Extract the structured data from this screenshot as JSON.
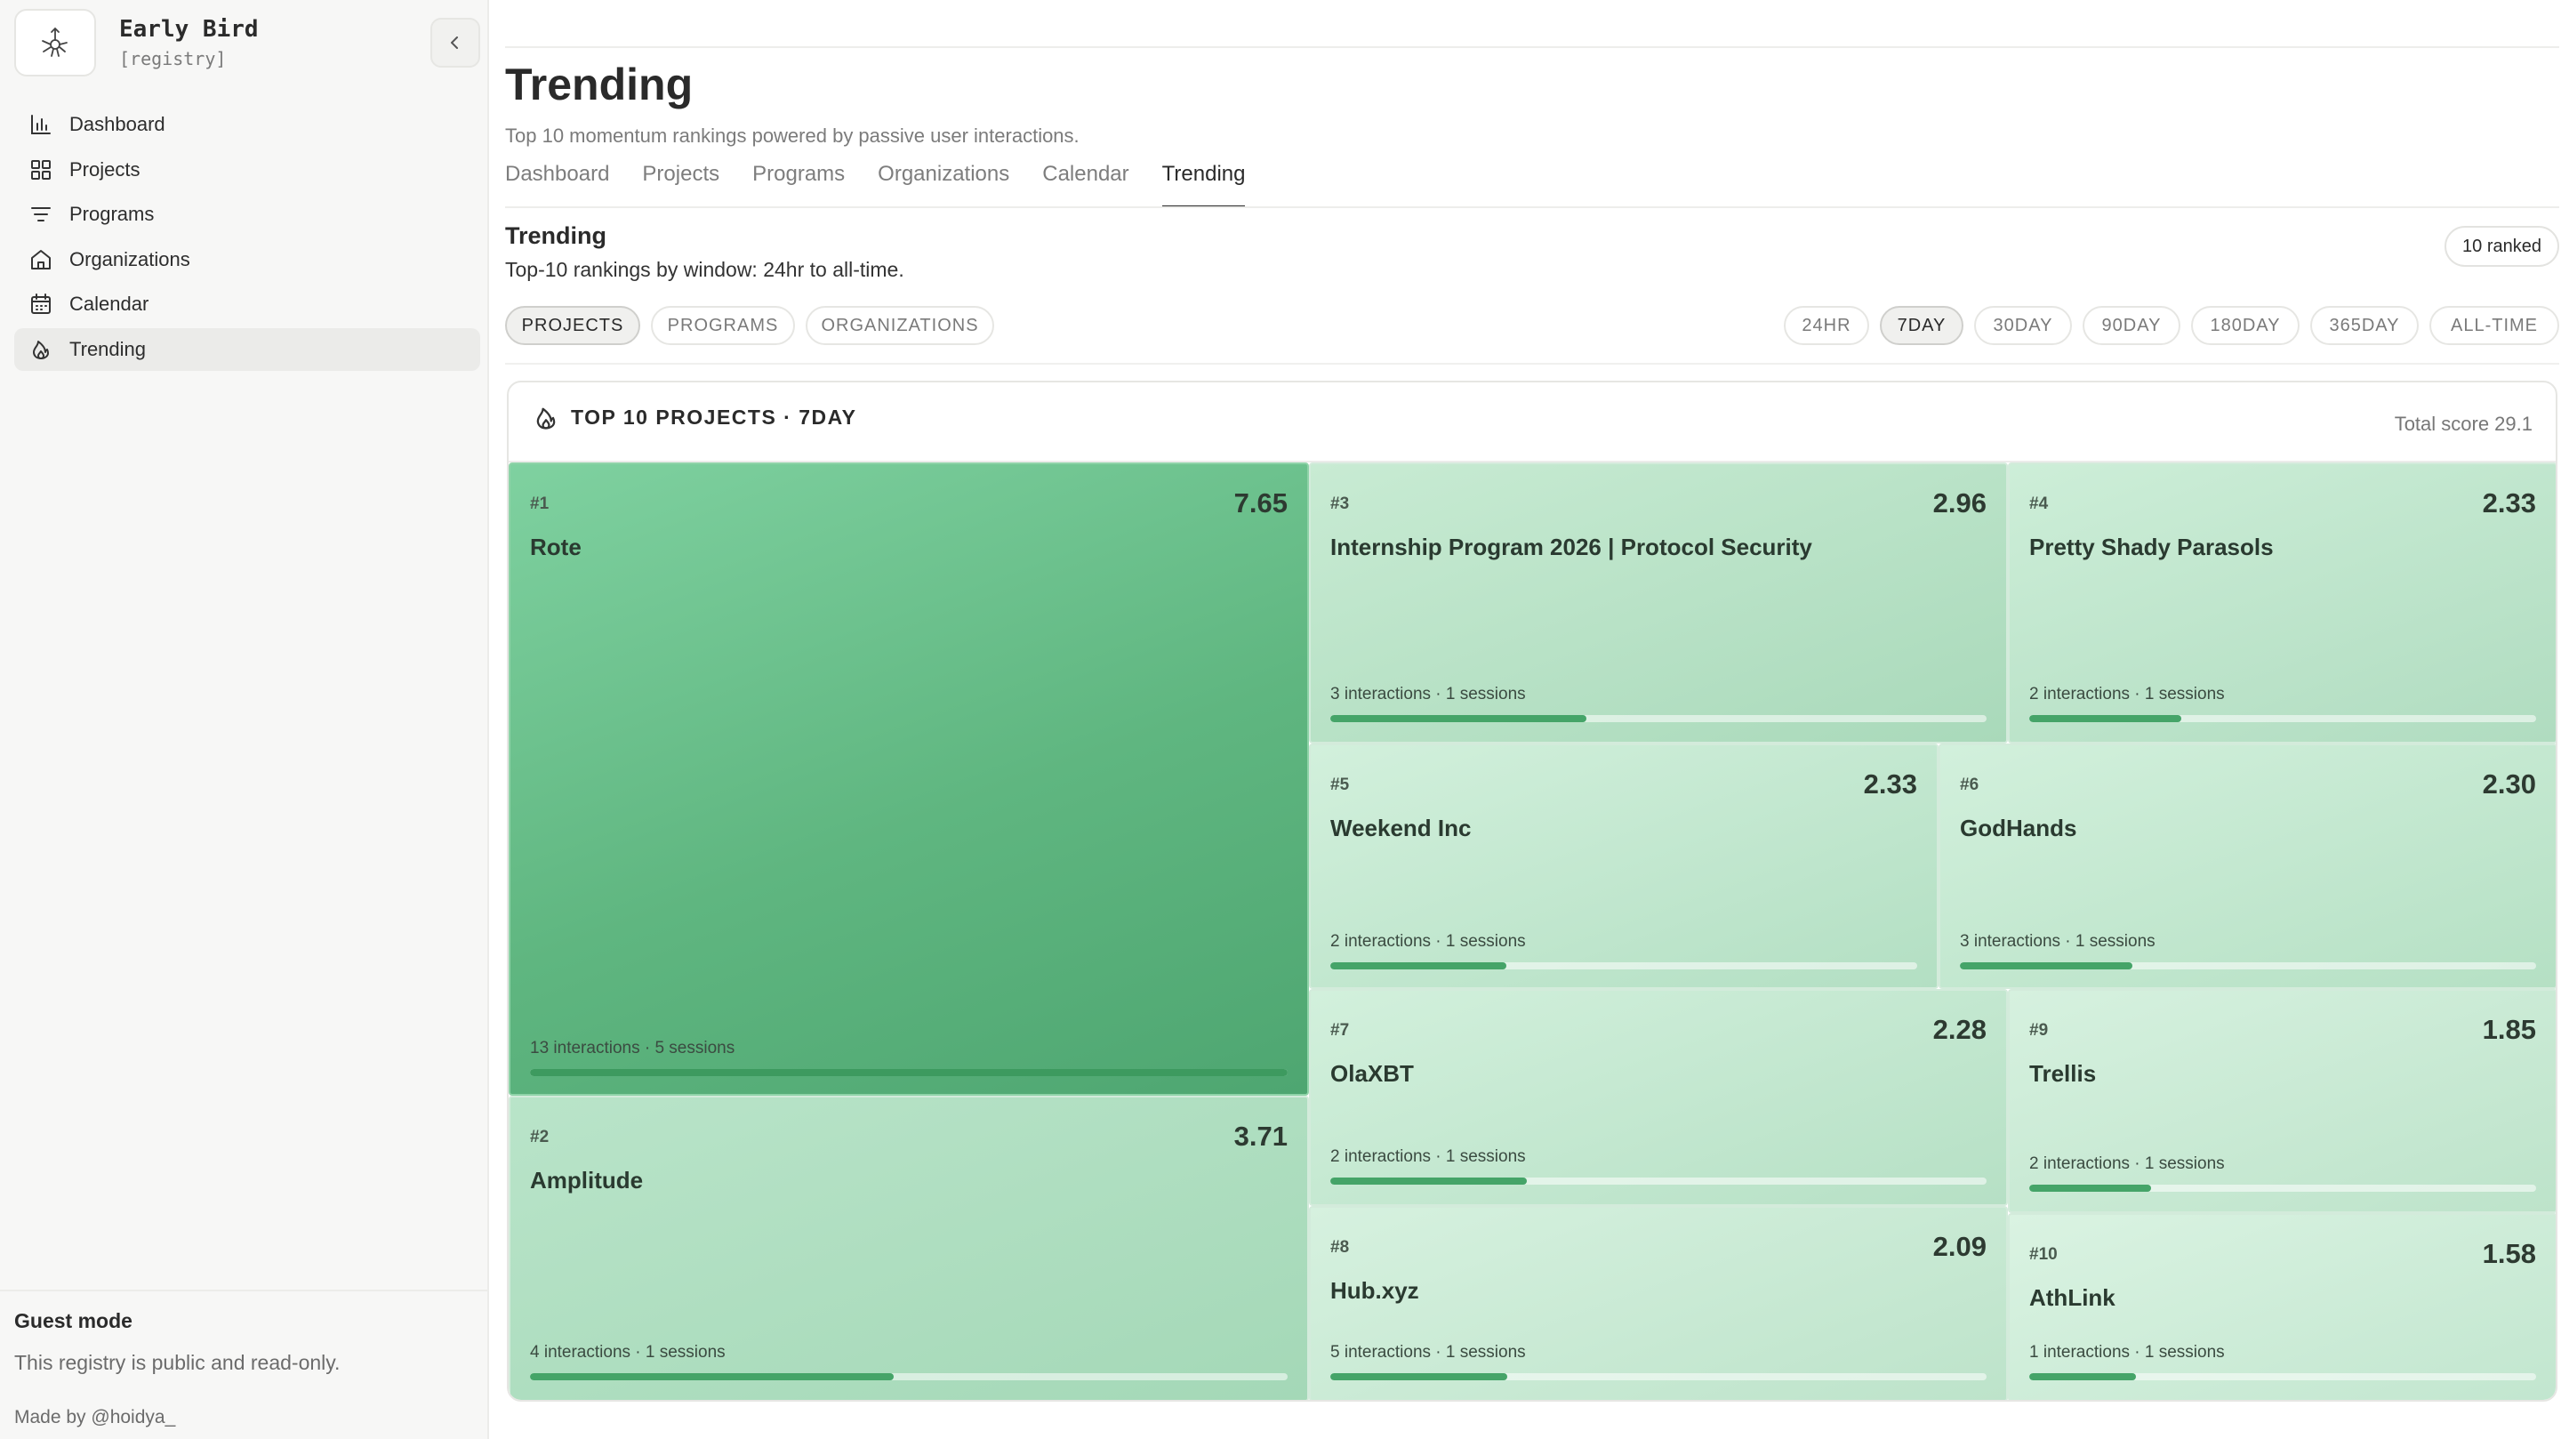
{
  "brand": {
    "name": "Early Bird",
    "sub": "[registry]"
  },
  "sidebar": {
    "items": [
      {
        "label": "Dashboard",
        "icon": "bar-chart-icon"
      },
      {
        "label": "Projects",
        "icon": "grid-icon"
      },
      {
        "label": "Programs",
        "icon": "filter-lines-icon"
      },
      {
        "label": "Organizations",
        "icon": "home-icon"
      },
      {
        "label": "Calendar",
        "icon": "calendar-icon"
      },
      {
        "label": "Trending",
        "icon": "flame-icon",
        "active": true
      }
    ],
    "guest_title": "Guest mode",
    "guest_desc": "This registry is public and read-only.",
    "made_by": "Made by @hoidya_"
  },
  "header": {
    "title": "Trending",
    "subtitle": "Top 10 momentum rankings powered by passive user interactions.",
    "tabs": [
      "Dashboard",
      "Projects",
      "Programs",
      "Organizations",
      "Calendar",
      "Trending"
    ],
    "active_tab": "Trending"
  },
  "section": {
    "title": "Trending",
    "subtitle": "Top-10 rankings by window: 24hr to all-time.",
    "ranked_badge": "10 ranked"
  },
  "filters": {
    "types": [
      "PROJECTS",
      "PROGRAMS",
      "ORGANIZATIONS"
    ],
    "active_type": "PROJECTS",
    "windows": [
      "24HR",
      "7DAY",
      "30DAY",
      "90DAY",
      "180DAY",
      "365DAY",
      "ALL-TIME"
    ],
    "active_window": "7DAY"
  },
  "panel": {
    "title": "TOP 10 PROJECTS · 7DAY",
    "total": "Total score 29.1"
  },
  "colors": {
    "accent": "#45a468",
    "tile_strong": "#5fb680",
    "tile_light": "#c6e8d1"
  },
  "items": [
    {
      "rank": "#1",
      "name": "Rote",
      "score": "7.65",
      "meta": "13 interactions · 5 sessions",
      "share": 1.0
    },
    {
      "rank": "#2",
      "name": "Amplitude",
      "score": "3.71",
      "meta": "4 interactions · 1 sessions",
      "share": 0.48
    },
    {
      "rank": "#3",
      "name": "Internship Program 2026 | Protocol Security",
      "score": "2.96",
      "meta": "3 interactions · 1 sessions",
      "share": 0.39
    },
    {
      "rank": "#4",
      "name": "Pretty Shady Parasols",
      "score": "2.33",
      "meta": "2 interactions · 1 sessions",
      "share": 0.3
    },
    {
      "rank": "#5",
      "name": "Weekend Inc",
      "score": "2.33",
      "meta": "2 interactions · 1 sessions",
      "share": 0.3
    },
    {
      "rank": "#6",
      "name": "GodHands",
      "score": "2.30",
      "meta": "3 interactions · 1 sessions",
      "share": 0.3
    },
    {
      "rank": "#7",
      "name": "OlaXBT",
      "score": "2.28",
      "meta": "2 interactions · 1 sessions",
      "share": 0.3
    },
    {
      "rank": "#8",
      "name": "Hub.xyz",
      "score": "2.09",
      "meta": "5 interactions · 1 sessions",
      "share": 0.27
    },
    {
      "rank": "#9",
      "name": "Trellis",
      "score": "1.85",
      "meta": "2 interactions · 1 sessions",
      "share": 0.24
    },
    {
      "rank": "#10",
      "name": "AthLink",
      "score": "1.58",
      "meta": "1 interactions · 1 sessions",
      "share": 0.21
    }
  ]
}
